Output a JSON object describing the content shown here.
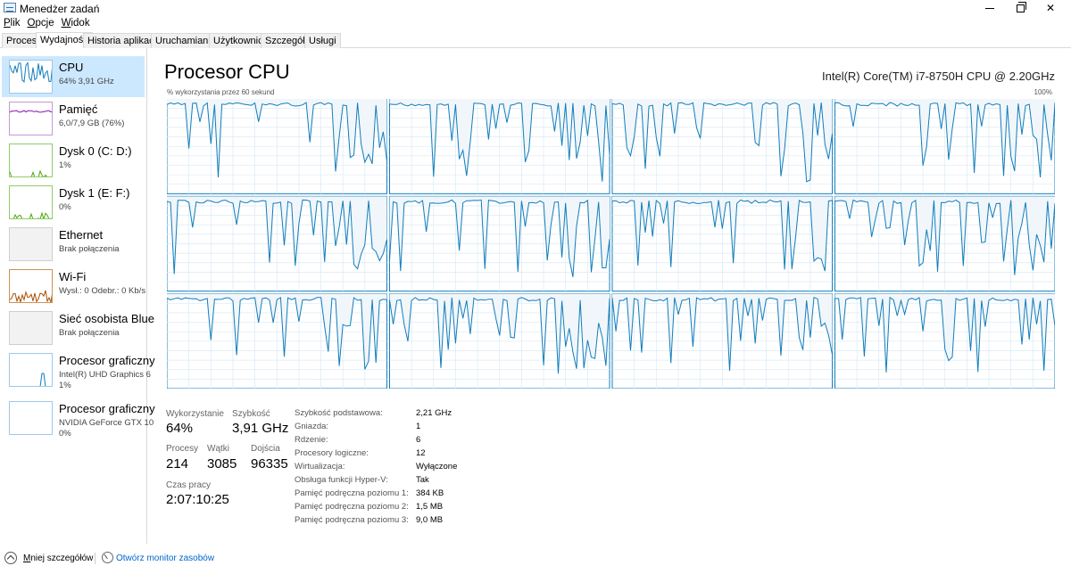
{
  "window": {
    "title": "Menedżer zadań"
  },
  "menu": [
    {
      "accel": "P",
      "rest": "lik"
    },
    {
      "accel": "O",
      "rest": "pcje"
    },
    {
      "accel": "W",
      "rest": "idok"
    }
  ],
  "tabs": [
    "Procesy",
    "Wydajność",
    "Historia aplikacji",
    "Uruchamianie",
    "Użytkownicy",
    "Szczegóły",
    "Usługi"
  ],
  "active_tab": "Wydajność",
  "sidebar": [
    {
      "title": "CPU",
      "sub": "64% 3,91 GHz",
      "sub2": "",
      "color": "#117dbb",
      "selected": true
    },
    {
      "title": "Pamięć",
      "sub": "6,0/7,9 GB (76%)",
      "sub2": "",
      "color": "#8b12ae",
      "selected": false
    },
    {
      "title": "Dysk 0 (C: D:)",
      "sub": "1%",
      "sub2": "",
      "color": "#4da60c",
      "selected": false
    },
    {
      "title": "Dysk 1 (E: F:)",
      "sub": "0%",
      "sub2": "",
      "color": "#4da60c",
      "selected": false
    },
    {
      "title": "Ethernet",
      "sub": "Brak połączenia",
      "sub2": "",
      "color": "#a74f01",
      "selected": false
    },
    {
      "title": "Wi-Fi",
      "sub": "Wysł.: 0 Odebr.: 0 Kb/s",
      "sub2": "",
      "color": "#a74f01",
      "selected": false
    },
    {
      "title": "Sieć osobista Blue",
      "sub": "Brak połączenia",
      "sub2": "",
      "color": "#a74f01",
      "selected": false
    },
    {
      "title": "Procesor graficzny",
      "sub": "Intel(R) UHD Graphics 6",
      "sub2": "1%",
      "color": "#117dbb",
      "selected": false
    },
    {
      "title": "Procesor graficzny",
      "sub": "NVIDIA GeForce GTX 10",
      "sub2": "0%",
      "color": "#117dbb",
      "selected": false
    }
  ],
  "main": {
    "title": "Procesor CPU",
    "cpu_model": "Intel(R) Core(TM) i7-8750H CPU @ 2.20GHz",
    "graph_caption": "% wykorzystania przez 60 sekund",
    "graph_max": "100%",
    "graph_color": "#117dbb",
    "graph_fill": "#f1f6fa",
    "graph_grid": "#d9eaf7"
  },
  "stats": {
    "utilization_label": "Wykorzystanie",
    "utilization_value": "64%",
    "speed_label": "Szybkość",
    "speed_value": "3,91 GHz",
    "processes_label": "Procesy",
    "processes_value": "214",
    "threads_label": "Wątki",
    "threads_value": "3085",
    "handles_label": "Dojścia",
    "handles_value": "96335",
    "uptime_label": "Czas pracy",
    "uptime_value": "2:07:10:25"
  },
  "specs": [
    {
      "label": "Szybkość podstawowa:",
      "value": "2,21 GHz"
    },
    {
      "label": "Gniazda:",
      "value": "1"
    },
    {
      "label": "Rdzenie:",
      "value": "6"
    },
    {
      "label": "Procesory logiczne:",
      "value": "12"
    },
    {
      "label": "Wirtualizacja:",
      "value": "Wyłączone"
    },
    {
      "label": "Obsługa funkcji Hyper-V:",
      "value": "Tak"
    },
    {
      "label": "Pamięć podręczna poziomu 1:",
      "value": "384 KB"
    },
    {
      "label": "Pamięć podręczna poziomu 2:",
      "value": "1,5 MB"
    },
    {
      "label": "Pamięć podręczna poziomu 3:",
      "value": "9,0 MB"
    }
  ],
  "footer": {
    "fewer_details": "Mniej szczegółów",
    "fewer_accel": "M",
    "fewer_rest": "niej szczegółów",
    "open_monitor": "Otwórz monitor zasobów"
  }
}
